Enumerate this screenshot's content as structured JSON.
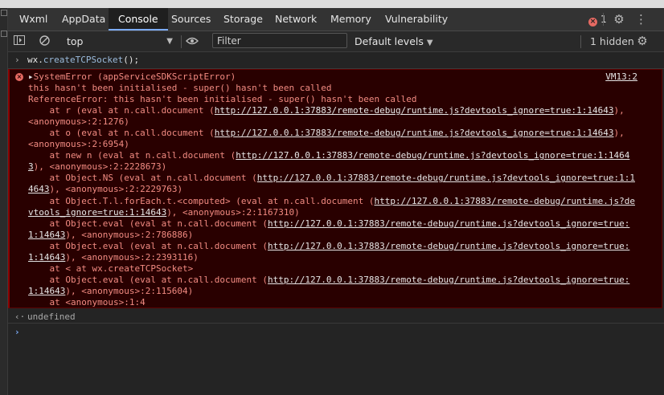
{
  "tabs": [
    "Wxml",
    "AppData",
    "Console",
    "Sources",
    "Storage",
    "Network",
    "Memory",
    "Vulnerability"
  ],
  "active_tab": "Console",
  "error_count": "1",
  "toolbar": {
    "context": "top",
    "filter_placeholder": "Filter",
    "levels_label": "Default levels",
    "hidden_label": "1 hidden"
  },
  "console": {
    "command_prefix": "wx.",
    "command_fn": "createTCPSocket",
    "command_suffix": "();",
    "error": {
      "source": "VM13:2",
      "title": "SystemError (appServiceSDKScriptError)",
      "lines": [
        [
          {
            "t": "this hasn't been initialised - super() hasn't been called"
          }
        ],
        [
          {
            "t": "ReferenceError: this hasn't been initialised - super() hasn't been called"
          }
        ],
        [
          {
            "t": "    at r (eval at n.call.document ("
          },
          {
            "t": "http://127.0.0.1:37883/remote-debug/runtime.js?devtools_ignore=true:1:14643",
            "link": true
          },
          {
            "t": "),"
          }
        ],
        [
          {
            "t": "<anonymous>:2:1276)"
          }
        ],
        [
          {
            "t": "    at o (eval at n.call.document ("
          },
          {
            "t": "http://127.0.0.1:37883/remote-debug/runtime.js?devtools_ignore=true:1:14643",
            "link": true
          },
          {
            "t": "),"
          }
        ],
        [
          {
            "t": "<anonymous>:2:6954)"
          }
        ],
        [
          {
            "t": "    at new n (eval at n.call.document ("
          },
          {
            "t": "http://127.0.0.1:37883/remote-debug/runtime.js?devtools_ignore=true:1:1464",
            "link": true
          }
        ],
        [
          {
            "t": "3",
            "link": true
          },
          {
            "t": "), <anonymous>:2:2228673)"
          }
        ],
        [
          {
            "t": "    at Object.NS (eval at n.call.document ("
          },
          {
            "t": "http://127.0.0.1:37883/remote-debug/runtime.js?devtools_ignore=true:1:1",
            "link": true
          }
        ],
        [
          {
            "t": "4643",
            "link": true
          },
          {
            "t": "), <anonymous>:2:2229763)"
          }
        ],
        [
          {
            "t": "    at Object.T.l.forEach.t.<computed> (eval at n.call.document ("
          },
          {
            "t": "http://127.0.0.1:37883/remote-debug/runtime.js?de",
            "link": true
          }
        ],
        [
          {
            "t": "vtools_ignore=true:1:14643",
            "link": true
          },
          {
            "t": "), <anonymous>:2:1167310)"
          }
        ],
        [
          {
            "t": "    at Object.eval (eval at n.call.document ("
          },
          {
            "t": "http://127.0.0.1:37883/remote-debug/runtime.js?devtools_ignore=true:",
            "link": true
          }
        ],
        [
          {
            "t": "1:14643",
            "link": true
          },
          {
            "t": "), <anonymous>:2:786886)"
          }
        ],
        [
          {
            "t": "    at Object.eval (eval at n.call.document ("
          },
          {
            "t": "http://127.0.0.1:37883/remote-debug/runtime.js?devtools_ignore=true:",
            "link": true
          }
        ],
        [
          {
            "t": "1:14643",
            "link": true
          },
          {
            "t": "), <anonymous>:2:2393116)"
          }
        ],
        [
          {
            "t": "    at < at wx.createTCPSocket>"
          }
        ],
        [
          {
            "t": "    at Object.eval (eval at n.call.document ("
          },
          {
            "t": "http://127.0.0.1:37883/remote-debug/runtime.js?devtools_ignore=true:",
            "link": true
          }
        ],
        [
          {
            "t": "1:14643",
            "link": true
          },
          {
            "t": "), <anonymous>:2:115604)"
          }
        ],
        [
          {
            "t": "    at <anonymous>:1:4"
          }
        ]
      ]
    },
    "result": "undefined"
  }
}
